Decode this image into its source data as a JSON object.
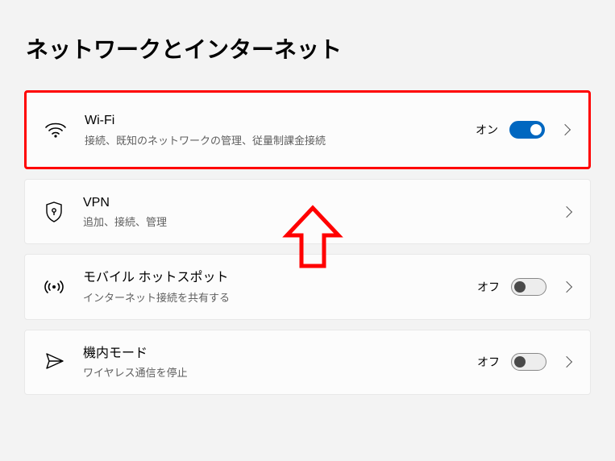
{
  "page": {
    "title": "ネットワークとインターネット"
  },
  "items": [
    {
      "icon": "wifi-icon",
      "title": "Wi-Fi",
      "subtitle": "接続、既知のネットワークの管理、従量制課金接続",
      "state_label": "オン",
      "toggle_on": true,
      "highlighted": true
    },
    {
      "icon": "vpn-icon",
      "title": "VPN",
      "subtitle": "追加、接続、管理",
      "state_label": "",
      "toggle_on": null,
      "highlighted": false
    },
    {
      "icon": "hotspot-icon",
      "title": "モバイル ホットスポット",
      "subtitle": "インターネット接続を共有する",
      "state_label": "オフ",
      "toggle_on": false,
      "highlighted": false
    },
    {
      "icon": "airplane-icon",
      "title": "機内モード",
      "subtitle": "ワイヤレス通信を停止",
      "state_label": "オフ",
      "toggle_on": false,
      "highlighted": false
    }
  ],
  "annotation": {
    "type": "up-arrow",
    "stroke": "#ff0000"
  }
}
